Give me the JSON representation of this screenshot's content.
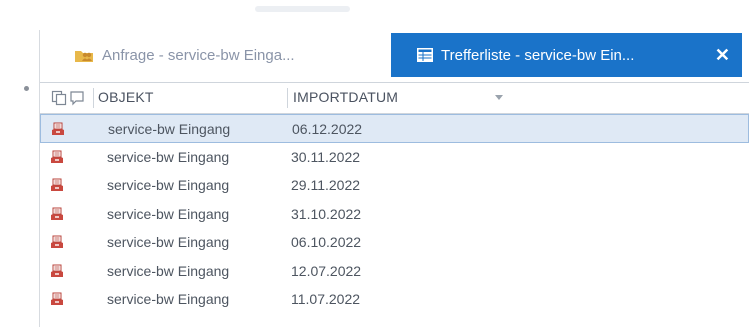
{
  "tabs": [
    {
      "label": "Anfrage - service-bw Einga...",
      "icon": "folder-people-icon",
      "active": false
    },
    {
      "label": "Trefferliste - service-bw Ein...",
      "icon": "table-list-icon",
      "active": true,
      "close_label": "✕"
    }
  ],
  "list": {
    "columns": [
      "OBJEKT",
      "IMPORTDATUM"
    ],
    "header_icons": [
      "copy-icon",
      "comment-icon"
    ],
    "sort_indicator": "sort-descending-icon",
    "rows": [
      {
        "objekt": "service-bw Eingang",
        "importdatum": "06.12.2022",
        "selected": true
      },
      {
        "objekt": "service-bw Eingang",
        "importdatum": "30.11.2022",
        "selected": false
      },
      {
        "objekt": "service-bw Eingang",
        "importdatum": "29.11.2022",
        "selected": false
      },
      {
        "objekt": "service-bw Eingang",
        "importdatum": "31.10.2022",
        "selected": false
      },
      {
        "objekt": "service-bw Eingang",
        "importdatum": "06.10.2022",
        "selected": false
      },
      {
        "objekt": "service-bw Eingang",
        "importdatum": "12.07.2022",
        "selected": false
      },
      {
        "objekt": "service-bw Eingang",
        "importdatum": "11.07.2022",
        "selected": false
      }
    ],
    "row_icon": "inbox-object-icon"
  },
  "colors": {
    "active_tab": "#1a73c9",
    "selected_row": "#dfe9f5",
    "inactive_tab_text": "#8a94a8"
  }
}
